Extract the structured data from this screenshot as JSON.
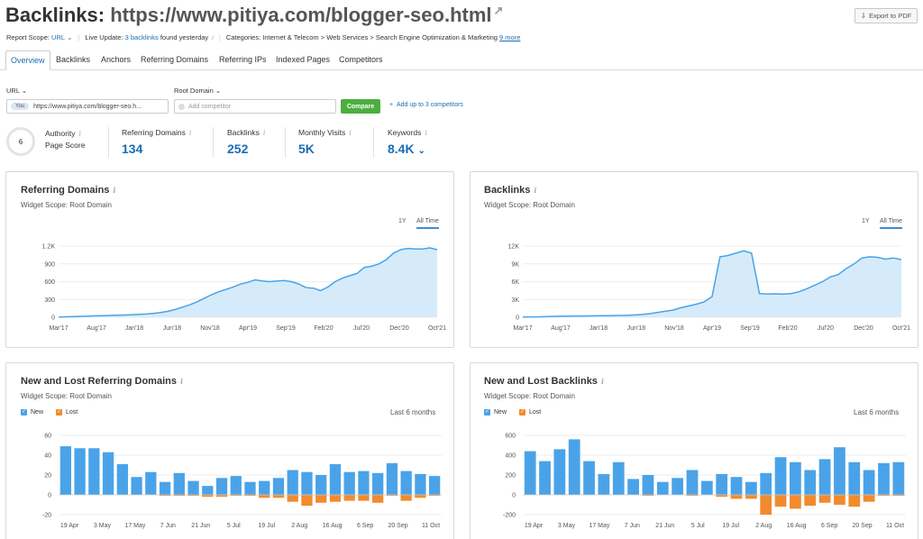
{
  "header": {
    "title_prefix": "Backlinks:",
    "title_url": "https://www.pitiya.com/blogger-seo.html",
    "external_icon": "external-link-icon",
    "export_label": "Export to PDF"
  },
  "meta": {
    "report_scope_label": "Report Scope:",
    "report_scope_value": "URL",
    "live_update_label": "Live Update:",
    "live_update_link": "3 backlinks",
    "live_update_suffix": "found yesterday",
    "categories_label": "Categories:",
    "categories_value": "Internet & Telecom > Web Services > Search Engine Optimization & Marketing",
    "categories_more": "9 more"
  },
  "tabs": [
    "Overview",
    "Backlinks",
    "Anchors",
    "Referring Domains",
    "Referring IPs",
    "Indexed Pages",
    "Competitors"
  ],
  "compare": {
    "url_label": "URL",
    "root_label": "Root Domain",
    "you_badge": "You",
    "url_value": "https://www.pitiya.com/blogger-seo.h...",
    "competitor_placeholder": "Add competitor",
    "compare_button": "Compare",
    "add_link": "Add up to 3 competitors"
  },
  "metrics": {
    "authority_score": "6",
    "authority_label_1": "Authority",
    "authority_label_2": "Page Score",
    "referring_domains_label": "Referring Domains",
    "referring_domains_value": "134",
    "backlinks_label": "Backlinks",
    "backlinks_value": "252",
    "monthly_visits_label": "Monthly Visits",
    "monthly_visits_value": "5K",
    "keywords_label": "Keywords",
    "keywords_value": "8.4K"
  },
  "panels": {
    "rd": {
      "title": "Referring Domains",
      "scope": "Widget Scope: Root Domain",
      "range_1y": "1Y",
      "range_all": "All Time"
    },
    "bl": {
      "title": "Backlinks",
      "scope": "Widget Scope: Root Domain",
      "range_1y": "1Y",
      "range_all": "All Time"
    },
    "nlrd": {
      "title": "New and Lost Referring Domains",
      "scope": "Widget Scope: Root Domain",
      "legend_new": "New",
      "legend_lost": "Lost",
      "period": "Last 6 months"
    },
    "nlbl": {
      "title": "New and Lost Backlinks",
      "scope": "Widget Scope: Root Domain",
      "legend_new": "New",
      "legend_lost": "Lost",
      "period": "Last 6 months"
    }
  },
  "colors": {
    "accent": "#1a6db3",
    "line": "#4aa3e8",
    "fill": "#d6ebf9",
    "new": "#4aa3e8",
    "lost": "#f28a2e",
    "green": "#4caf3f"
  },
  "chart_data": [
    {
      "id": "rd",
      "type": "area",
      "title": "Referring Domains",
      "xticks": [
        "Mar'17",
        "Aug'17",
        "Jan'18",
        "Jun'18",
        "Nov'18",
        "Apr'19",
        "Sep'19",
        "Feb'20",
        "Jul'20",
        "Dec'20",
        "Oct'21"
      ],
      "yticks": [
        "0",
        "300",
        "600",
        "900",
        "1.2K"
      ],
      "ylim": [
        0,
        1200
      ],
      "values": [
        5,
        8,
        12,
        15,
        20,
        25,
        28,
        30,
        35,
        38,
        42,
        48,
        55,
        65,
        80,
        100,
        130,
        170,
        210,
        260,
        320,
        380,
        430,
        470,
        510,
        560,
        590,
        630,
        610,
        600,
        610,
        620,
        600,
        560,
        500,
        490,
        450,
        510,
        600,
        660,
        700,
        740,
        840,
        860,
        900,
        970,
        1080,
        1140,
        1160,
        1150,
        1150,
        1170,
        1140
      ]
    },
    {
      "id": "bl",
      "type": "area",
      "title": "Backlinks",
      "xticks": [
        "Mar'17",
        "Aug'17",
        "Jan'18",
        "Jun'18",
        "Nov'18",
        "Apr'19",
        "Sep'19",
        "Feb'20",
        "Jul'20",
        "Dec'20",
        "Oct'21"
      ],
      "yticks": [
        "0",
        "3K",
        "6K",
        "9K",
        "12K"
      ],
      "ylim": [
        0,
        12000
      ],
      "values": [
        40,
        60,
        80,
        120,
        150,
        180,
        200,
        220,
        230,
        250,
        260,
        280,
        300,
        320,
        380,
        450,
        600,
        800,
        1000,
        1200,
        1600,
        1900,
        2200,
        2600,
        3500,
        10200,
        10400,
        10800,
        11200,
        10800,
        4000,
        3900,
        3950,
        3900,
        4000,
        4300,
        4800,
        5400,
        6000,
        6800,
        7200,
        8200,
        9000,
        10000,
        10200,
        10100,
        9800,
        10000,
        9700
      ]
    },
    {
      "id": "nlrd",
      "type": "bar",
      "title": "New and Lost Referring Domains",
      "xticks": [
        "19 Apr",
        "3 May",
        "17 May",
        "7 Jun",
        "21 Jun",
        "5 Jul",
        "19 Jul",
        "2 Aug",
        "16 Aug",
        "6 Sep",
        "20 Sep",
        "11 Oct"
      ],
      "yticks": [
        "-20",
        "0",
        "20",
        "40",
        "60"
      ],
      "ylim": [
        -20,
        60
      ],
      "series": [
        {
          "name": "New",
          "values": [
            49,
            47,
            47,
            43,
            31,
            18,
            23,
            13,
            22,
            14,
            9,
            17,
            19,
            13,
            14,
            17,
            25,
            23,
            20,
            31,
            23,
            24,
            22,
            32,
            24,
            21,
            19
          ]
        },
        {
          "name": "Lost",
          "values": [
            0,
            0,
            0,
            0,
            0,
            0,
            0,
            -1,
            -1,
            -1,
            -2,
            -2,
            -1,
            -1,
            -3,
            -3,
            -7,
            -11,
            -8,
            -7,
            -6,
            -6,
            -8,
            -1,
            -6,
            -3,
            -1
          ]
        }
      ]
    },
    {
      "id": "nlbl",
      "type": "bar",
      "title": "New and Lost Backlinks",
      "xticks": [
        "19 Apr",
        "3 May",
        "17 May",
        "7 Jun",
        "21 Jun",
        "5 Jul",
        "19 Jul",
        "2 Aug",
        "16 Aug",
        "6 Sep",
        "20 Sep",
        "11 Oct"
      ],
      "yticks": [
        "-200",
        "0",
        "200",
        "400",
        "600"
      ],
      "ylim": [
        -200,
        600
      ],
      "series": [
        {
          "name": "New",
          "values": [
            440,
            340,
            460,
            560,
            340,
            210,
            330,
            160,
            200,
            130,
            170,
            250,
            140,
            210,
            180,
            130,
            220,
            380,
            330,
            250,
            360,
            480,
            330,
            250,
            320,
            330
          ]
        },
        {
          "name": "Lost",
          "values": [
            0,
            0,
            0,
            0,
            0,
            0,
            0,
            0,
            -10,
            0,
            0,
            -10,
            0,
            -20,
            -40,
            -40,
            -200,
            -120,
            -140,
            -110,
            -80,
            -100,
            -120,
            -70,
            -10,
            -10
          ]
        }
      ]
    }
  ]
}
